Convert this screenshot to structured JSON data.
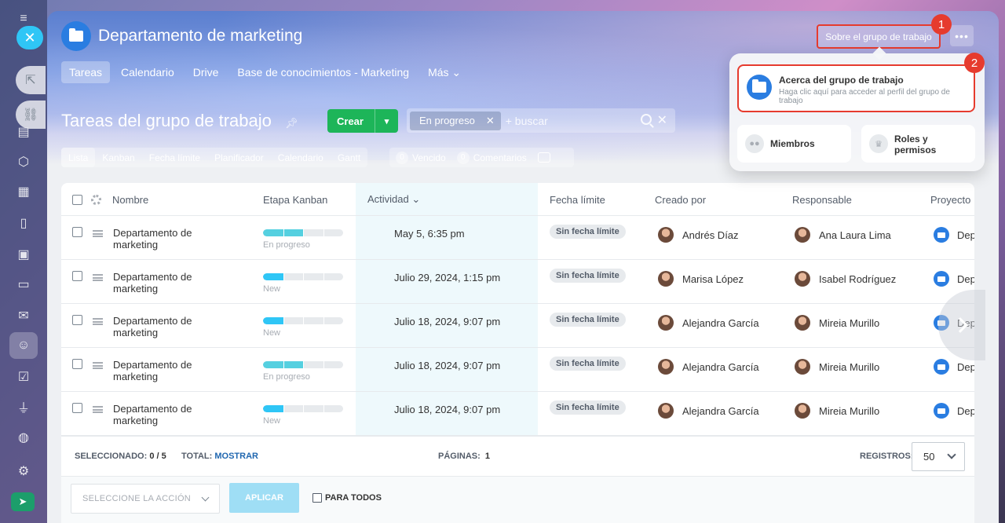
{
  "panel": {
    "title": "Departamento de marketing",
    "about_button": "Sobre el grupo de trabajo",
    "more_button": "•••",
    "badges": [
      "1",
      "2"
    ]
  },
  "tabs": [
    {
      "label": "Tareas"
    },
    {
      "label": "Calendario"
    },
    {
      "label": "Drive"
    },
    {
      "label": "Base de conocimientos - Marketing"
    },
    {
      "label": "Más ⌄"
    }
  ],
  "toolbar": {
    "title": "Tareas del grupo de trabajo",
    "create_label": "Crear",
    "filter_chip": "En progreso",
    "search_placeholder": "+ buscar"
  },
  "views": [
    "Lista",
    "Kanban",
    "Fecha límite",
    "Planificador",
    "Calendario",
    "Gantt"
  ],
  "counters": [
    {
      "num": "0",
      "label": "Vencido"
    },
    {
      "num": "0",
      "label": "Comentarios"
    }
  ],
  "grid": {
    "headers": {
      "name": "Nombre",
      "kanban": "Etapa Kanban",
      "activity": "Actividad ⌄",
      "deadline": "Fecha límite",
      "created_by": "Creado por",
      "responsible": "Responsable",
      "project": "Proyecto"
    },
    "rows": [
      {
        "name": "Departamento de marketing",
        "stage": "En progreso",
        "progress": 0.5,
        "stage_color": "#55d0e0",
        "activity": "May 5, 6:35 pm",
        "deadline": "Sin fecha límite",
        "created_by": "Andrés Díaz",
        "responsible": "Ana Laura Lima",
        "project": "Dep"
      },
      {
        "name": "Departamento de marketing",
        "stage": "New",
        "progress": 0.25,
        "stage_color": "#2fc6f6",
        "activity": "Julio 29, 2024, 1:15 pm",
        "deadline": "Sin fecha límite",
        "created_by": "Marisa López",
        "responsible": "Isabel Rodríguez",
        "project": "Dep"
      },
      {
        "name": "Departamento de marketing",
        "stage": "New",
        "progress": 0.25,
        "stage_color": "#2fc6f6",
        "activity": "Julio 18, 2024, 9:07 pm",
        "deadline": "Sin fecha límite",
        "created_by": "Alejandra García",
        "responsible": "Mireia Murillo",
        "project": "Dep"
      },
      {
        "name": "Departamento de marketing",
        "stage": "En progreso",
        "progress": 0.5,
        "stage_color": "#55d0e0",
        "activity": "Julio 18, 2024, 9:07 pm",
        "deadline": "Sin fecha límite",
        "created_by": "Alejandra García",
        "responsible": "Mireia Murillo",
        "project": "Dep"
      },
      {
        "name": "Departamento de marketing",
        "stage": "New",
        "progress": 0.25,
        "stage_color": "#2fc6f6",
        "activity": "Julio 18, 2024, 9:07 pm",
        "deadline": "Sin fecha límite",
        "created_by": "Alejandra García",
        "responsible": "Mireia Murillo",
        "project": "Dep"
      }
    ]
  },
  "footer": {
    "selected_label": "SELECCIONADO:",
    "selected_value": "0 / 5",
    "total_label": "TOTAL:",
    "total_link": "MOSTRAR",
    "pages_label": "PÁGINAS:",
    "pages_value": "1",
    "records_label": "REGISTROS:",
    "records_value": "50"
  },
  "actions": {
    "select_placeholder": "SELECCIONE LA ACCIÓN",
    "apply": "APLICAR",
    "for_all": "PARA TODOS"
  },
  "popup": {
    "about_title": "Acerca del grupo de trabajo",
    "about_desc": "Haga clic aquí para acceder al perfil del grupo de trabajo",
    "members": "Miembros",
    "roles_line1": "Roles y",
    "roles_line2": "permisos"
  },
  "colors": {
    "accent": "#2fc6f6",
    "create": "#1db559",
    "highlight": "#e63b2e",
    "link": "#2067b0"
  }
}
